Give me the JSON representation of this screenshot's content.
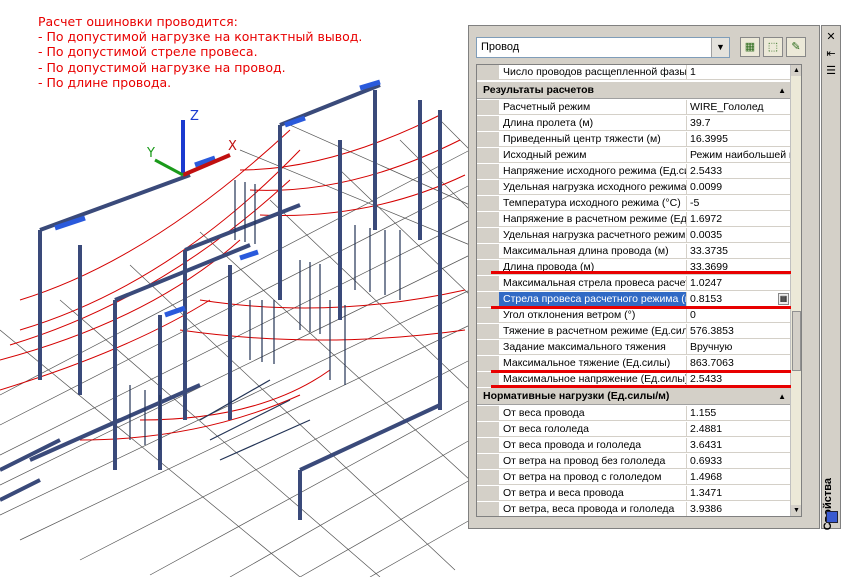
{
  "annotation": {
    "lines": [
      "Расчет ошиновки проводится:",
      "- По допустимой нагрузке на контактный вывод.",
      "- По допустимой стреле провеса.",
      "- По допустимой нагрузке на провод.",
      "- По длине провода."
    ],
    "color": "#e80000"
  },
  "palette": {
    "title": "Свойства",
    "object_type": "Провод",
    "top_row": {
      "name": "Число проводов расщепленной фазы",
      "value": "1"
    },
    "sections": [
      {
        "title": "Результаты расчетов",
        "rows": [
          {
            "name": "Расчетный режим",
            "value": "WIRE_Гололед"
          },
          {
            "name": "Длина пролета (м)",
            "value": "39.7"
          },
          {
            "name": "Приведенный центр тяжести (м)",
            "value": "16.3995"
          },
          {
            "name": "Исходный режим",
            "value": "Режим наибольшей на..."
          },
          {
            "name": "Напряжение исходного режима (Ед.си...",
            "value": "2.5433"
          },
          {
            "name": "Удельная нагрузка исходного режима...",
            "value": "0.0099"
          },
          {
            "name": "Температура исходного режима (°C)",
            "value": "-5"
          },
          {
            "name": "Напряжение в расчетном режиме (Ед.с...",
            "value": "1.6972"
          },
          {
            "name": "Удельная нагрузка расчетного режим...",
            "value": "0.0035"
          },
          {
            "name": "Максимальная длина провода (м)",
            "value": "33.3735"
          },
          {
            "name": "Длина провода (м)",
            "value": "33.3699"
          },
          {
            "name": "Максимальная стрела провеса расчет...",
            "value": "1.0247"
          },
          {
            "name": "Стрела провеса расчетного режима (м)",
            "value": "0.8153"
          },
          {
            "name": "Угол отклонения ветром (°)",
            "value": "0"
          },
          {
            "name": "Тяжение в расчетном режиме (Ед.силы)",
            "value": "576.3853"
          },
          {
            "name": "Задание максимального тяжения",
            "value": "Вручную"
          },
          {
            "name": "Максимальное тяжение (Ед.силы)",
            "value": "863.7063"
          },
          {
            "name": "Максимальное напряжение (Ед.силы)",
            "value": "2.5433"
          }
        ]
      },
      {
        "title": "Нормативные нагрузки (Ед.силы/м)",
        "rows": [
          {
            "name": "От веса провода",
            "value": "1.155"
          },
          {
            "name": "От веса гололеда",
            "value": "2.4881"
          },
          {
            "name": "От веса провода и гололеда",
            "value": "3.6431"
          },
          {
            "name": "От ветра на провод без гололеда",
            "value": "0.6933"
          },
          {
            "name": "От ветра на провод с гололедом",
            "value": "1.4968"
          },
          {
            "name": "От ветра и веса провода",
            "value": "1.3471"
          },
          {
            "name": "От ветра, веса провода и гололеда",
            "value": "3.9386"
          }
        ]
      }
    ],
    "selected_row": "Стрела провеса расчетного режима (м)",
    "highlight_color": "#316ac5"
  },
  "ucs": {
    "x": "X",
    "y": "Y",
    "z": "Z"
  },
  "icons": [
    "quick-select-icon",
    "select-objects-icon",
    "toggle-pickadd-icon",
    "close-icon",
    "auto-hide-icon",
    "properties-menu-icon",
    "chevron-down-icon"
  ]
}
